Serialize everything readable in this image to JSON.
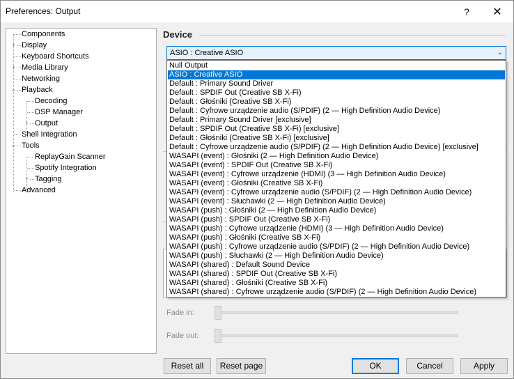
{
  "window": {
    "title": "Preferences: Output",
    "help_glyph": "?",
    "close_glyph": "✕"
  },
  "tree": {
    "items": [
      {
        "label": "Components"
      },
      {
        "label": "Display",
        "expander": "›"
      },
      {
        "label": "Keyboard Shortcuts"
      },
      {
        "label": "Media Library",
        "expander": "›"
      },
      {
        "label": "Networking"
      },
      {
        "label": "Playback",
        "expander": "⌄"
      },
      {
        "label": "Decoding"
      },
      {
        "label": "DSP Manager"
      },
      {
        "label": "Output",
        "expander": "›"
      },
      {
        "label": "Shell Integration"
      },
      {
        "label": "Tools",
        "expander": "⌄"
      },
      {
        "label": "ReplayGain Scanner"
      },
      {
        "label": "Spotify Integration"
      },
      {
        "label": "Tagging",
        "expander": "›"
      },
      {
        "label": "Advanced"
      }
    ]
  },
  "device": {
    "section_title": "Device",
    "selected_value": "ASIO : Creative ASIO",
    "arrow_glyph": "⌄",
    "options": [
      "Null Output",
      "ASIO : Creative ASIO",
      "Default : Primary Sound Driver",
      "Default : SPDIF Out (Creative SB X-Fi)",
      "Default : Głośniki (Creative SB X-Fi)",
      "Default : Cyfrowe urządzenie audio (S/PDIF) (2 — High Definition Audio Device)",
      "Default : Primary Sound Driver [exclusive]",
      "Default : SPDIF Out (Creative SB X-Fi) [exclusive]",
      "Default : Głośniki (Creative SB X-Fi) [exclusive]",
      "Default : Cyfrowe urządzenie audio (S/PDIF) (2 — High Definition Audio Device) [exclusive]",
      "WASAPI (event) : Głośniki (2 — High Definition Audio Device)",
      "WASAPI (event) : SPDIF Out (Creative SB X-Fi)",
      "WASAPI (event) : Cyfrowe urządzenie (HDMI) (3 — High Definition Audio Device)",
      "WASAPI (event) : Głośniki (Creative SB X-Fi)",
      "WASAPI (event) : Cyfrowe urządzenie audio (S/PDIF) (2 — High Definition Audio Device)",
      "WASAPI (event) : Słuchawki (2 — High Definition Audio Device)",
      "WASAPI (push) : Głośniki (2 — High Definition Audio Device)",
      "WASAPI (push) : SPDIF Out (Creative SB X-Fi)",
      "WASAPI (push) : Cyfrowe urządzenie (HDMI) (3 — High Definition Audio Device)",
      "WASAPI (push) : Głośniki (Creative SB X-Fi)",
      "WASAPI (push) : Cyfrowe urządzenie audio (S/PDIF) (2 — High Definition Audio Device)",
      "WASAPI (push) : Słuchawki (2 — High Definition Audio Device)",
      "WASAPI (shared) : Default Sound Device",
      "WASAPI (shared) : SPDIF Out (Creative SB X-Fi)",
      "WASAPI (shared) : Głośniki (Creative SB X-Fi)",
      "WASAPI (shared) : Cyfrowe urządzenie audio (S/PDIF) (2 — High Definition Audio Device)"
    ]
  },
  "fade": {
    "fade_in_label": "Fade in:",
    "fade_out_label": "Fade out:"
  },
  "buttons": {
    "reset_all": "Reset all",
    "reset_page": "Reset page",
    "ok": "OK",
    "cancel": "Cancel",
    "apply": "Apply"
  },
  "colors": {
    "accent": "#0078d7",
    "selection": "#0078d7"
  }
}
